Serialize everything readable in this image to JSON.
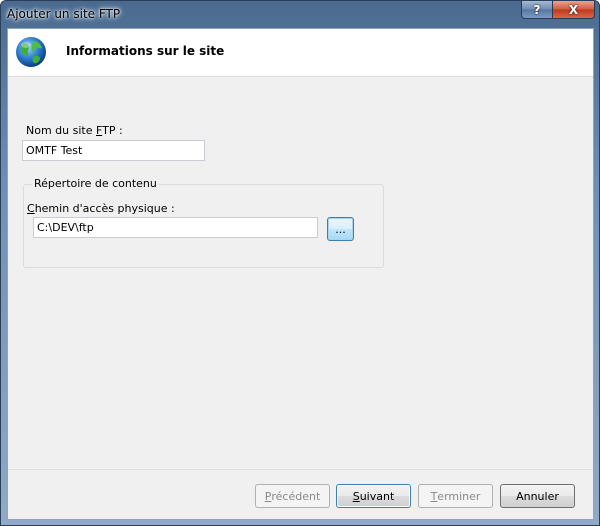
{
  "window": {
    "title": "Ajouter un site FTP",
    "help_label": "?",
    "close_label": "X"
  },
  "header": {
    "icon": "globe-icon",
    "title": "Informations sur le site"
  },
  "form": {
    "site_name_label_pre": "Nom du site ",
    "site_name_label_accel": "F",
    "site_name_label_post": "TP :",
    "site_name_value": "OMTF Test",
    "content_group_label": "Répertoire de contenu",
    "path_label_accel": "C",
    "path_label_post": "hemin d'accès physique :",
    "path_value": "C:\\DEV\\ftp",
    "browse_label": "..."
  },
  "buttons": {
    "previous_accel": "P",
    "previous_rest": "récédent",
    "next_accel": "S",
    "next_rest": "uivant",
    "finish_accel": "T",
    "finish_rest": "erminer",
    "cancel": "Annuler"
  },
  "colors": {
    "title_gradient_top": "#4a6a8f",
    "close_button": "#c1381c",
    "focus_border": "#3c7fb1"
  }
}
